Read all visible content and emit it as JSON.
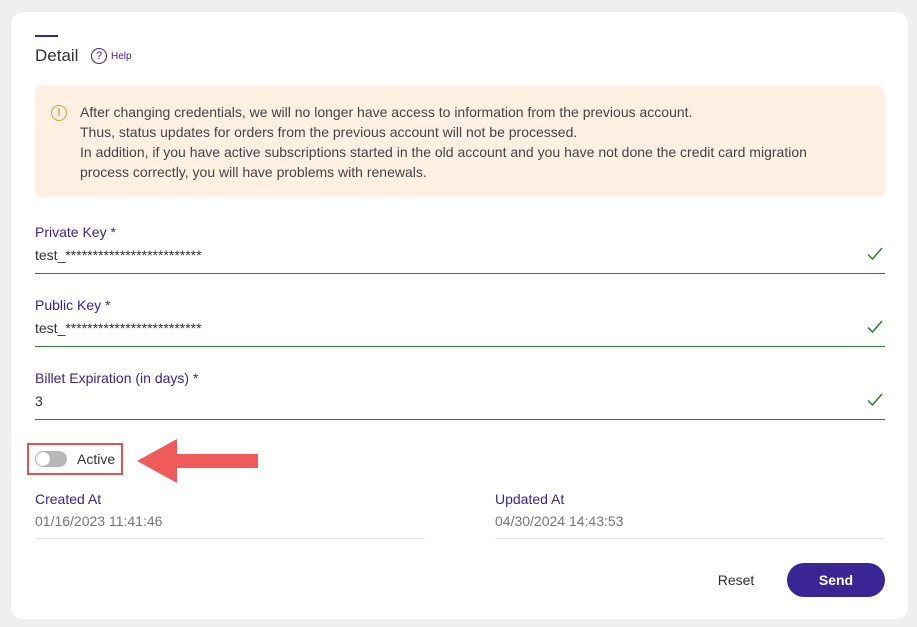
{
  "header": {
    "title": "Detail",
    "help_label": "Help",
    "help_icon": "?"
  },
  "alert": {
    "icon": "!",
    "lines": [
      "After changing credentials, we will no longer have access to information from the previous account.",
      "Thus, status updates for orders from the previous account will not be processed.",
      "In addition, if you have active subscriptions started in the old account and you have not done the credit card migration",
      "process correctly, you will have problems with renewals."
    ]
  },
  "fields": [
    {
      "label": "Private Key *",
      "value": "test_*************************"
    },
    {
      "label": "Public Key *",
      "value": "test_*************************"
    },
    {
      "label": "Billet Expiration (in days) *",
      "value": "3"
    }
  ],
  "active_toggle": {
    "label": "Active",
    "checked": false
  },
  "meta": {
    "created": {
      "label": "Created At",
      "value": "01/16/2023 11:41:46"
    },
    "updated": {
      "label": "Updated At",
      "value": "04/30/2024 14:43:53"
    }
  },
  "actions": {
    "reset_label": "Reset",
    "send_label": "Send"
  },
  "colors": {
    "primary": "#3b2494",
    "valid": "#2e7d32",
    "alert_bg": "#fff0e3",
    "alert_icon": "#e59a2f",
    "highlight": "#e05353",
    "toggle_off": "#b8b8b8"
  }
}
